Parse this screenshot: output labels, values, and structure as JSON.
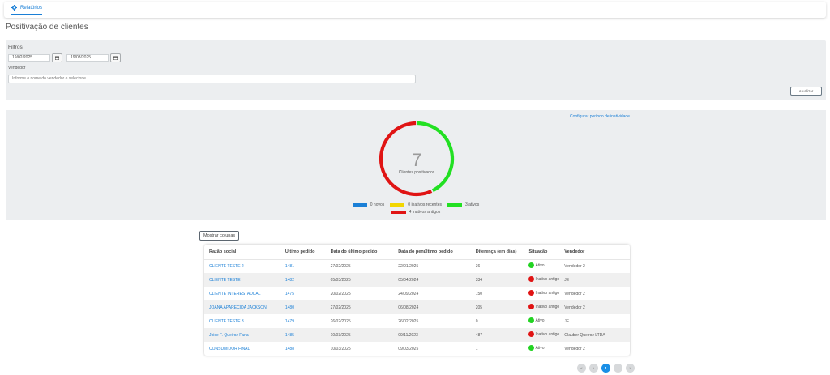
{
  "breadcrumb": {
    "label": "Relatórios",
    "icon": "gear-icon"
  },
  "page_title": "Positivação de clientes",
  "filters": {
    "title": "Filtros",
    "date_start": "19/02/2025",
    "date_end": "19/03/2025",
    "vendor_label": "Vendedor",
    "vendor_placeholder": "Informe o nome do vendedor e selecione",
    "update_button": "Atualizar"
  },
  "chart_panel": {
    "config_link": "Configurar período de inatividade"
  },
  "chart_data": {
    "type": "pie",
    "center_value": "7",
    "center_label": "Clientes positivados",
    "slices": [
      {
        "label": "novos",
        "value": 0,
        "color": "#1a7fd6"
      },
      {
        "label": "inativos recentes",
        "value": 0,
        "color": "#f2d600"
      },
      {
        "label": "ativos",
        "value": 3,
        "color": "#22e022"
      },
      {
        "label": "inativos antigos",
        "value": 4,
        "color": "#e01414"
      }
    ]
  },
  "legend": {
    "novos": "0 novos",
    "inativos_recentes": "0 inativos recentes",
    "ativos": "3 ativos",
    "inativos_antigos": "4 inativos antigos"
  },
  "show_columns_button": "Mostrar colunas",
  "table": {
    "headers": [
      "Razão social",
      "Último pedido",
      "Data do último pedido",
      "Data do penúltimo pedido",
      "Diferença (em dias)",
      "Situação",
      "Vendedor"
    ],
    "rows": [
      {
        "razao": "CLIENTE TESTE 2",
        "ultimo": "1481",
        "data_ultimo": "27/02/2025",
        "data_penultimo": "22/01/2025",
        "diferenca": "36",
        "situacao": "Ativo",
        "status_color": "#22d322",
        "vendedor": "Vendedor 2"
      },
      {
        "razao": "CLIENTE TESTE",
        "ultimo": "1482",
        "data_ultimo": "05/03/2025",
        "data_penultimo": "05/04/2024",
        "diferenca": "334",
        "situacao": "Inativo antigo",
        "status_color": "#e01414",
        "vendedor": "JE"
      },
      {
        "razao": "CLIENTE INTERESTADUAL",
        "ultimo": "1475",
        "data_ultimo": "20/02/2025",
        "data_penultimo": "24/09/2024",
        "diferenca": "150",
        "situacao": "Inativo antigo",
        "status_color": "#e01414",
        "vendedor": "Vendedor 2"
      },
      {
        "razao": "JOANA APARECIDA JACKSON",
        "ultimo": "1480",
        "data_ultimo": "27/02/2025",
        "data_penultimo": "06/08/2024",
        "diferenca": "205",
        "situacao": "Inativo antigo",
        "status_color": "#e01414",
        "vendedor": "Vendedor 2"
      },
      {
        "razao": "CLIENTE TESTE 3",
        "ultimo": "1479",
        "data_ultimo": "26/02/2025",
        "data_penultimo": "26/02/2025",
        "diferenca": "0",
        "situacao": "Ativo",
        "status_color": "#22d322",
        "vendedor": "JE"
      },
      {
        "razao": "Joice F. Queiroz Faria",
        "ultimo": "1485",
        "data_ultimo": "10/03/2025",
        "data_penultimo": "09/11/2023",
        "diferenca": "487",
        "situacao": "Inativo antigo",
        "status_color": "#e01414",
        "vendedor": "Glauber Queiroz LTDA"
      },
      {
        "razao": "CONSUMIDOR FINAL",
        "ultimo": "1488",
        "data_ultimo": "10/03/2025",
        "data_penultimo": "09/03/2025",
        "diferenca": "1",
        "situacao": "Ativo",
        "status_color": "#22d322",
        "vendedor": "Vendedor 2"
      }
    ]
  },
  "pager": {
    "first": "«",
    "prev": "‹",
    "current": "1",
    "next": "›",
    "last": "»"
  }
}
